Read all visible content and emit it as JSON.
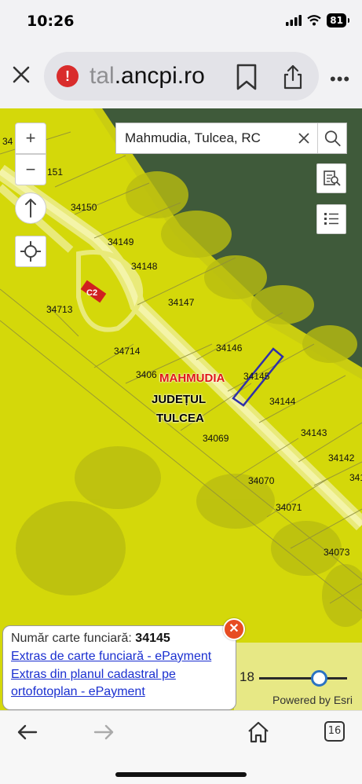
{
  "status_bar": {
    "time": "10:26",
    "battery": "81"
  },
  "browser": {
    "url_faded": "tal",
    "url_main": ".ancpi.ro",
    "more_label": "•••"
  },
  "map": {
    "search": {
      "value": "Mahmudia, Tulcea, RC"
    },
    "controls": {
      "zoom_in": "+",
      "zoom_out": "−"
    },
    "parcels": [
      "34",
      "151",
      "34150",
      "34149",
      "34148",
      "34147",
      "34713",
      "34714",
      "34146",
      "34145",
      "3406",
      "34144",
      "34069",
      "34143",
      "34142",
      "341",
      "34070",
      "34071",
      "34073",
      "C2"
    ],
    "places": {
      "locality": "MAHMUDIA",
      "county_line1": "JUDEȚUL",
      "county_line2": "TULCEA"
    },
    "scale_text": "18",
    "zoom_level_fraction": 0.68,
    "attribution": "Powered by Esri",
    "colors": {
      "parcel_fill": "#d4d80a",
      "water": "#3f5a3a",
      "highlight": "#3030a8"
    }
  },
  "popup": {
    "label": "Număr carte funciară:",
    "number": "34145",
    "links": [
      "Extras de carte funciară - ePayment",
      "Extras din planul cadastral pe",
      "ortofotoplan - ePayment"
    ],
    "close_label": "✕"
  },
  "nav": {
    "tabs_count": "16"
  }
}
